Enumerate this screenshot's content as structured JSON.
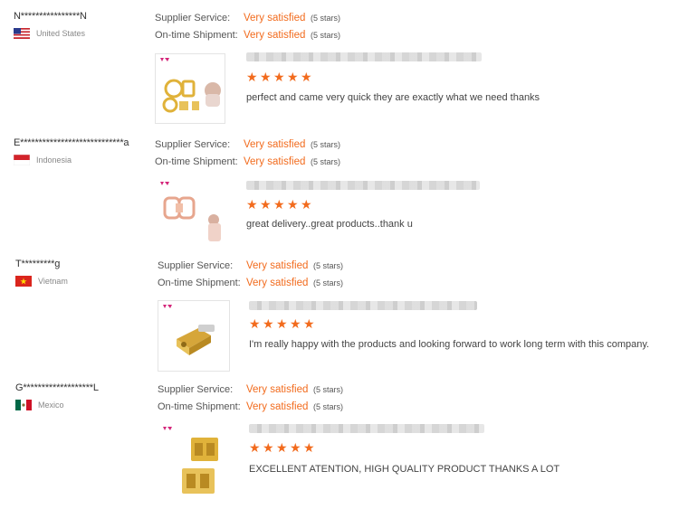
{
  "reviews": [
    {
      "buyer": "N****************N",
      "country": "United States",
      "flag": "us-flag-icon",
      "supplier_label": "Supplier Service:",
      "supplier_value": "Very satisfied",
      "supplier_stars": "(5 stars)",
      "shipment_label": "On-time Shipment:",
      "shipment_value": "Very satisfied",
      "shipment_stars": "(5 stars)",
      "rating_stars": 5,
      "feedback": "perfect and came very quick they are exactly what we need thanks"
    },
    {
      "buyer": "E****************************a",
      "country": "Indonesia",
      "flag": "indonesia-flag-icon",
      "supplier_label": "Supplier Service:",
      "supplier_value": "Very satisfied",
      "supplier_stars": "(5 stars)",
      "shipment_label": "On-time Shipment:",
      "shipment_value": "Very satisfied",
      "shipment_stars": "(5 stars)",
      "rating_stars": 5,
      "feedback": "great delivery..great products..thank u"
    },
    {
      "buyer": "T*********g",
      "country": "Vietnam",
      "flag": "vietnam-flag-icon",
      "supplier_label": "Supplier Service:",
      "supplier_value": "Very satisfied",
      "supplier_stars": "(5 stars)",
      "shipment_label": "On-time Shipment:",
      "shipment_value": "Very satisfied",
      "shipment_stars": "(5 stars)",
      "rating_stars": 5,
      "feedback": "I'm really happy with the products and looking forward to work long term with this company."
    },
    {
      "buyer": "G*******************L",
      "country": "Mexico",
      "flag": "mexico-flag-icon",
      "supplier_label": "Supplier Service:",
      "supplier_value": "Very satisfied",
      "supplier_stars": "(5 stars)",
      "shipment_label": "On-time Shipment:",
      "shipment_value": "Very satisfied",
      "shipment_stars": "(5 stars)",
      "rating_stars": 5,
      "feedback": "EXCELLENT ATENTION, HIGH QUALITY PRODUCT THANKS A LOT"
    }
  ],
  "colors": {
    "accent": "#f26b1d",
    "gold": "#e0b23a"
  }
}
